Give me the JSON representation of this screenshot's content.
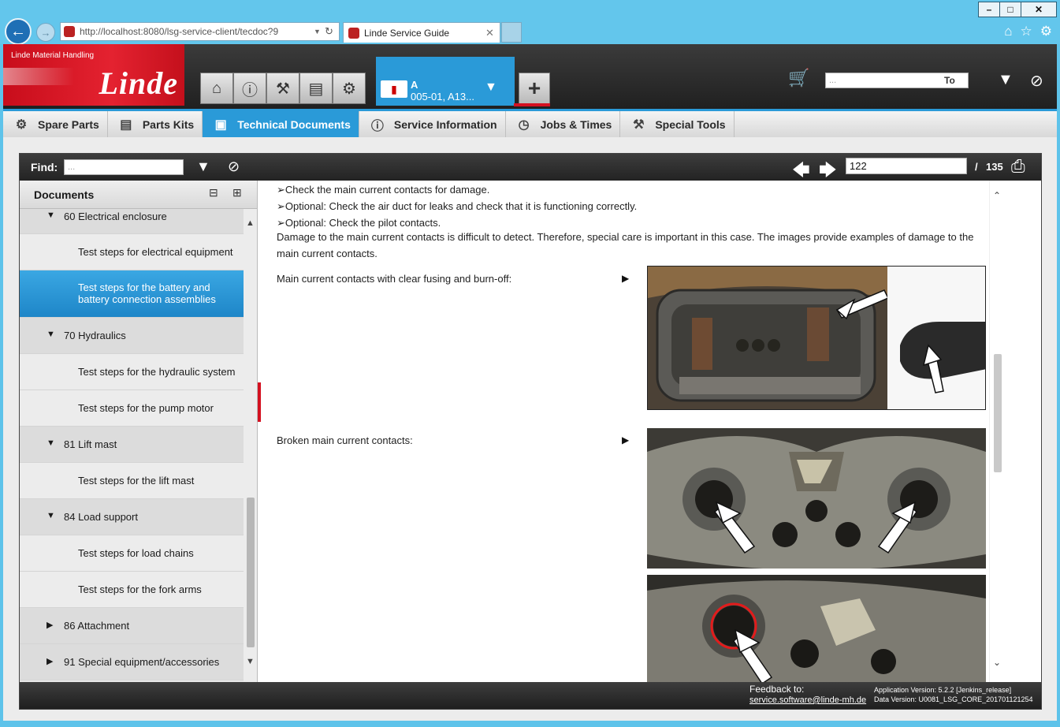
{
  "browser": {
    "url": "http://localhost:8080/lsg-service-client/tecdoc?9",
    "tab_title": "Linde Service Guide",
    "win_minimize": "–",
    "win_maximize": "□",
    "win_close": "✕",
    "back_icon": "arrow-left",
    "forward_icon": "arrow-right"
  },
  "header": {
    "brand_small": "Linde Material Handling",
    "brand": "Linde",
    "vehicle": {
      "line1": "A",
      "line2": "005-01, A13..."
    },
    "search_placeholder": "...",
    "search_selector": "To"
  },
  "modules": [
    {
      "label": "Spare Parts",
      "icon": "spare-parts-icon",
      "active": false
    },
    {
      "label": "Parts Kits",
      "icon": "parts-kits-icon",
      "active": false
    },
    {
      "label": "Technical Documents",
      "icon": "technical-documents-icon",
      "active": true
    },
    {
      "label": "Service Information",
      "icon": "info-icon",
      "active": false
    },
    {
      "label": "Jobs & Times",
      "icon": "jobs-times-icon",
      "active": false
    },
    {
      "label": "Special Tools",
      "icon": "special-tools-icon",
      "active": false
    }
  ],
  "find": {
    "label": "Find:",
    "placeholder": "...",
    "page_current": "122",
    "page_separator": "/",
    "page_total": "135"
  },
  "documents": {
    "title": "Documents",
    "tree": [
      {
        "type": "cat",
        "label": "60 Electrical enclosure",
        "expanded": true
      },
      {
        "type": "doc",
        "label": "Test steps for electrical equipment"
      },
      {
        "type": "sel",
        "label": "Test steps for the battery and battery connection assemblies"
      },
      {
        "type": "cat",
        "label": "70 Hydraulics",
        "expanded": true
      },
      {
        "type": "doc",
        "label": "Test steps for the hydraulic system"
      },
      {
        "type": "doc",
        "label": "Test steps for the pump motor"
      },
      {
        "type": "cat",
        "label": "81 Lift mast",
        "expanded": true
      },
      {
        "type": "doc",
        "label": "Test steps for the lift mast"
      },
      {
        "type": "cat",
        "label": "84 Load support",
        "expanded": true
      },
      {
        "type": "doc",
        "label": "Test steps for load chains"
      },
      {
        "type": "doc",
        "label": "Test steps for the fork arms"
      },
      {
        "type": "cat",
        "label": "86 Attachment",
        "expanded": false
      },
      {
        "type": "cat",
        "label": "91 Special equipment/accessories",
        "expanded": false
      }
    ]
  },
  "content": {
    "bullet_marker": "➢",
    "bullets": [
      "Check the main current contacts for damage.",
      "Optional: Check the air duct for leaks and check that it is functioning correctly.",
      "Optional: Check the pilot contacts."
    ],
    "paragraph": "Damage to the main current contacts is difficult to detect. Therefore, special care is important in this case. The images provide examples of damage to the main current contacts.",
    "figure1_caption": "Main current contacts with clear fusing and burn-off:",
    "figure2_caption": "Broken main current contacts:"
  },
  "footer": {
    "feedback_label": "Feedback to:",
    "feedback_email": "service.software@linde-mh.de",
    "app_version": "Application Version: 5.2.2 [Jenkins_release]",
    "data_version": "Data Version: U0081_LSG_CORE_201701121254"
  },
  "colors": {
    "accent": "#2a9ad8",
    "brand_red": "#d41020",
    "dark_bar": "#2d2d2d"
  }
}
